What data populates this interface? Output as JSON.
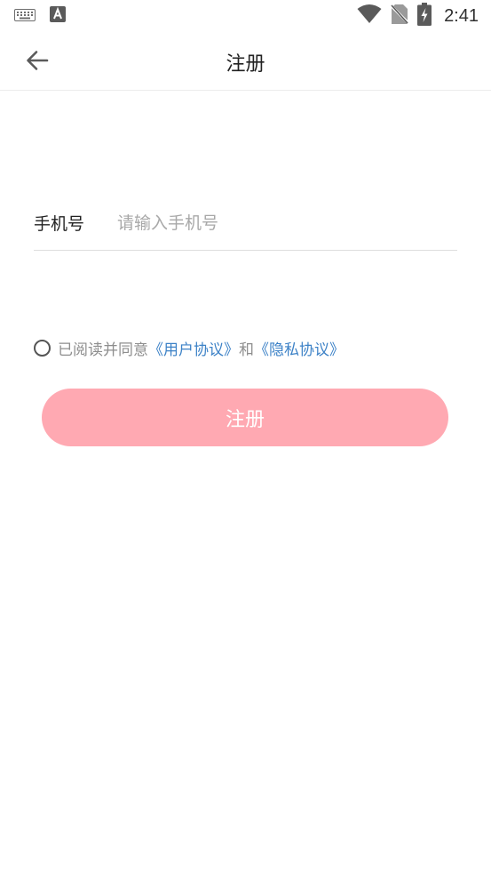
{
  "status_bar": {
    "time": "2:41",
    "left_icons": [
      "keyboard-icon",
      "text-a-icon"
    ],
    "right_icons": [
      "wifi-icon",
      "no-sim-icon",
      "battery-charging-icon"
    ]
  },
  "app_bar": {
    "back_icon": "arrow-left-icon",
    "title": "注册"
  },
  "form": {
    "phone_label": "手机号",
    "phone_placeholder": "请输入手机号",
    "phone_value": ""
  },
  "agreement": {
    "checked": false,
    "prefix": "已阅读并同意",
    "user_agreement_link": "《用户协议》",
    "connector": "和",
    "privacy_policy_link": "《隐私协议》"
  },
  "register_button": {
    "label": "注册",
    "color": "#ffa9b2"
  },
  "colors": {
    "link": "#3d82c7",
    "hint": "#a8a8a8",
    "title": "#222222"
  }
}
